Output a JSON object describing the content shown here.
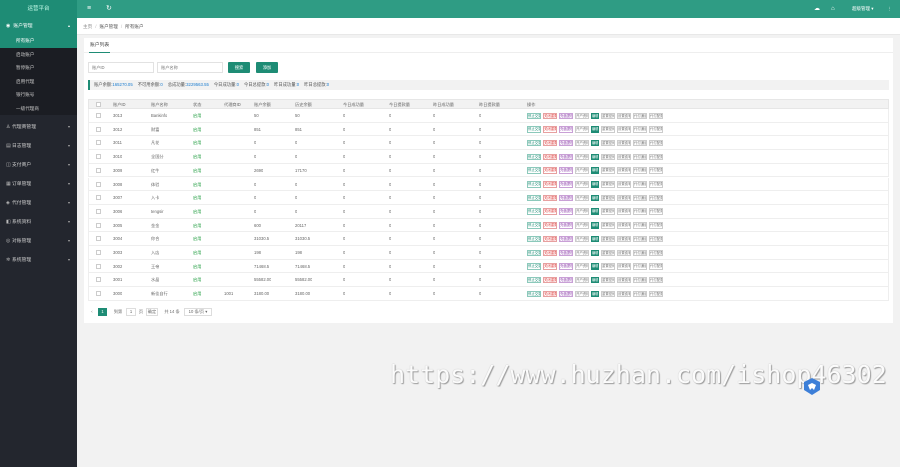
{
  "app": {
    "title": "运营平台"
  },
  "header": {
    "user": "超级管理",
    "caret": "▾",
    "more": "⋮"
  },
  "sidebar": {
    "groups": [
      {
        "label": "账户管理",
        "icon": "user-icon",
        "glyph": "◉",
        "expanded": true,
        "items": [
          "所有账户",
          "启动账户",
          "暂停账户",
          "启用代理",
          "银行账号",
          "一级代理商"
        ]
      },
      {
        "label": "代理商管理",
        "icon": "agent-icon",
        "glyph": "♙"
      },
      {
        "label": "日志管理",
        "icon": "log-icon",
        "glyph": "▤"
      },
      {
        "label": "支付商户",
        "icon": "merchant-icon",
        "glyph": "◫"
      },
      {
        "label": "订单管理",
        "icon": "order-icon",
        "glyph": "▦"
      },
      {
        "label": "代付管理",
        "icon": "pay-icon",
        "glyph": "◈"
      },
      {
        "label": "系统资料",
        "icon": "data-icon",
        "glyph": "◧"
      },
      {
        "label": "对账管理",
        "icon": "reconcile-icon",
        "glyph": "◎"
      },
      {
        "label": "系统管理",
        "icon": "settings-icon",
        "glyph": "✲"
      }
    ]
  },
  "breadcrumb": [
    "主页",
    "账户管理",
    "所有账户"
  ],
  "card": {
    "tab": "账户列表"
  },
  "search": {
    "account_placeholder": "账户ID",
    "name_placeholder": "账户名称",
    "search_label": "搜索",
    "add_label": "添加"
  },
  "stats": [
    {
      "label": "账户余额",
      "value": "165270.05"
    },
    {
      "label": "不可用余额",
      "value": "0"
    },
    {
      "label": "总成功量",
      "value": "3229563.55"
    },
    {
      "label": "今日成功量",
      "value": "0"
    },
    {
      "label": "今日总提款",
      "value": "0"
    },
    {
      "label": "昨日成功量",
      "value": "0"
    },
    {
      "label": "昨日总提款",
      "value": "0"
    }
  ],
  "table": {
    "headers": [
      "账户ID",
      "账户名称",
      "状态",
      "代理商ID",
      "账户余额",
      "历史余额",
      "今日成功量",
      "今日提款量",
      "昨日成功量",
      "昨日提款量",
      "操作"
    ],
    "rows": [
      {
        "id": "3013",
        "name": "Bankinfo",
        "status": "启用",
        "agent": "",
        "balance": "50",
        "history": "50",
        "t1": "0",
        "t2": "0",
        "t3": "0",
        "t4": "0"
      },
      {
        "id": "3012",
        "name": "财富",
        "status": "启用",
        "agent": "",
        "balance": "851",
        "history": "851",
        "t1": "0",
        "t2": "0",
        "t3": "0",
        "t4": "0"
      },
      {
        "id": "3011",
        "name": "凡花",
        "status": "启用",
        "agent": "",
        "balance": "0",
        "history": "0",
        "t1": "0",
        "t2": "0",
        "t3": "0",
        "t4": "0"
      },
      {
        "id": "3010",
        "name": "全国分",
        "status": "启用",
        "agent": "",
        "balance": "0",
        "history": "0",
        "t1": "0",
        "t2": "0",
        "t3": "0",
        "t4": "0"
      },
      {
        "id": "3009",
        "name": "红牛",
        "status": "启用",
        "agent": "",
        "balance": "2690",
        "history": "17170",
        "t1": "0",
        "t2": "0",
        "t3": "0",
        "t4": "0"
      },
      {
        "id": "3008",
        "name": "体验",
        "status": "启用",
        "agent": "",
        "balance": "0",
        "history": "0",
        "t1": "0",
        "t2": "0",
        "t3": "0",
        "t4": "0"
      },
      {
        "id": "3007",
        "name": "入卡",
        "status": "启用",
        "agent": "",
        "balance": "0",
        "history": "0",
        "t1": "0",
        "t2": "0",
        "t3": "0",
        "t4": "0"
      },
      {
        "id": "3006",
        "name": "tengsir",
        "status": "启用",
        "agent": "",
        "balance": "0",
        "history": "0",
        "t1": "0",
        "t2": "0",
        "t3": "0",
        "t4": "0"
      },
      {
        "id": "3005",
        "name": "金金",
        "status": "启用",
        "agent": "",
        "balance": "600",
        "history": "20117",
        "t1": "0",
        "t2": "0",
        "t3": "0",
        "t4": "0"
      },
      {
        "id": "3004",
        "name": "你合",
        "status": "启用",
        "agent": "",
        "balance": "31030.5",
        "history": "31030.5",
        "t1": "0",
        "t2": "0",
        "t3": "0",
        "t4": "0"
      },
      {
        "id": "3003",
        "name": "入店",
        "status": "启用",
        "agent": "",
        "balance": "198",
        "history": "198",
        "t1": "0",
        "t2": "0",
        "t3": "0",
        "t4": "0"
      },
      {
        "id": "3002",
        "name": "王帝",
        "status": "启用",
        "agent": "",
        "balance": "71468.5",
        "history": "71468.5",
        "t1": "0",
        "t2": "0",
        "t3": "0",
        "t4": "0"
      },
      {
        "id": "3001",
        "name": "水晶",
        "status": "启用",
        "agent": "",
        "balance": "55582.00",
        "history": "55582.00",
        "t1": "0",
        "t2": "0",
        "t3": "0",
        "t4": "0"
      },
      {
        "id": "3000",
        "name": "新佳自行",
        "status": "启用",
        "agent": "1001",
        "balance": "3180.00",
        "history": "3180.00",
        "t1": "0",
        "t2": "0",
        "t3": "0",
        "t4": "0"
      }
    ],
    "actions": [
      {
        "label": "停止交易",
        "style": "green"
      },
      {
        "label": "关闭重置",
        "style": "red"
      },
      {
        "label": "充值提现",
        "style": "purple"
      },
      {
        "label": "开户资料",
        "style": "gray"
      },
      {
        "label": "编辑",
        "style": "solid"
      },
      {
        "label": "重置密码",
        "style": "gray"
      },
      {
        "label": "设置费率",
        "style": "gray"
      },
      {
        "label": "代付通道",
        "style": "gray"
      },
      {
        "label": "代付配置",
        "style": "gray"
      }
    ]
  },
  "pager": {
    "prev": "‹",
    "current": "1",
    "goto_label": "到第",
    "page_input": "1",
    "page_unit": "页",
    "confirm": "确定",
    "total": "共 14 条",
    "per_page": "10 条/页 ▾"
  },
  "watermark": "https://www.huzhan.com/ishop46302",
  "colors": {
    "primary": "#1e8c75",
    "header": "#2f9c84",
    "sidebar": "#23262e"
  }
}
